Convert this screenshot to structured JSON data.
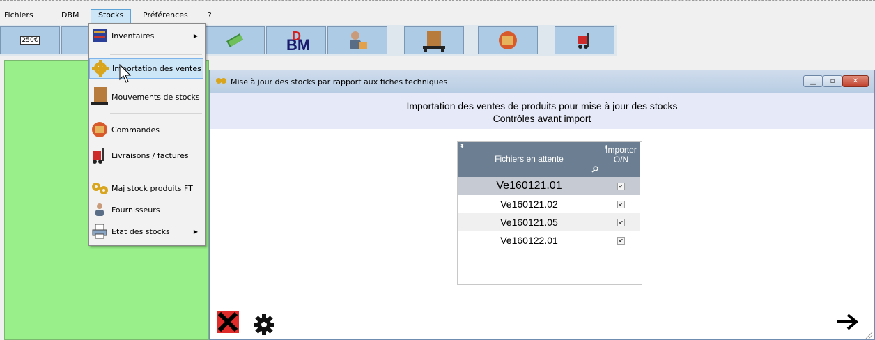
{
  "menubar": {
    "items": [
      "Fichiers",
      "DBM",
      "Stocks",
      "Préférences",
      "?"
    ]
  },
  "toolbar": {
    "first_button": "250€"
  },
  "dropdown": {
    "items": [
      {
        "label": "Inventaires",
        "icon": "inventory-icon",
        "submenu": true
      },
      {
        "label": "Importation des ventes",
        "icon": "gears-icon",
        "submenu": false
      },
      {
        "label": "Mouvements de stocks",
        "icon": "crate-icon",
        "submenu": false
      },
      {
        "label": "Commandes",
        "icon": "boxes-icon",
        "submenu": false
      },
      {
        "label": "Livraisons / factures",
        "icon": "forklift-icon",
        "submenu": false
      },
      {
        "label": "Maj stock produits FT",
        "icon": "gears-icon",
        "submenu": false
      },
      {
        "label": "Fournisseurs",
        "icon": "person-icon",
        "submenu": false
      },
      {
        "label": "Etat des stocks",
        "icon": "printer-icon",
        "submenu": true
      }
    ]
  },
  "window": {
    "title": "Mise à jour des stocks par rapport aux fiches techniques",
    "header_line1": "Importation des ventes de produits pour mise à jour des stocks",
    "header_line2": "Contrôles avant import",
    "table": {
      "col1": "Fichiers en attente",
      "col2_line1": "Importer",
      "col2_line2": "O/N",
      "rows": [
        {
          "file": "Ve160121.01",
          "checked": true
        },
        {
          "file": "Ve160121.02",
          "checked": true
        },
        {
          "file": "Ve160121.05",
          "checked": true
        },
        {
          "file": "Ve160122.01",
          "checked": true
        }
      ]
    }
  },
  "colors": {
    "green_pane": "#99f08a",
    "toolbar_button": "#aecbe6",
    "table_header": "#6c7f92",
    "selected_row": "#c6cbd3",
    "cancel_red": "#e02b2b"
  }
}
